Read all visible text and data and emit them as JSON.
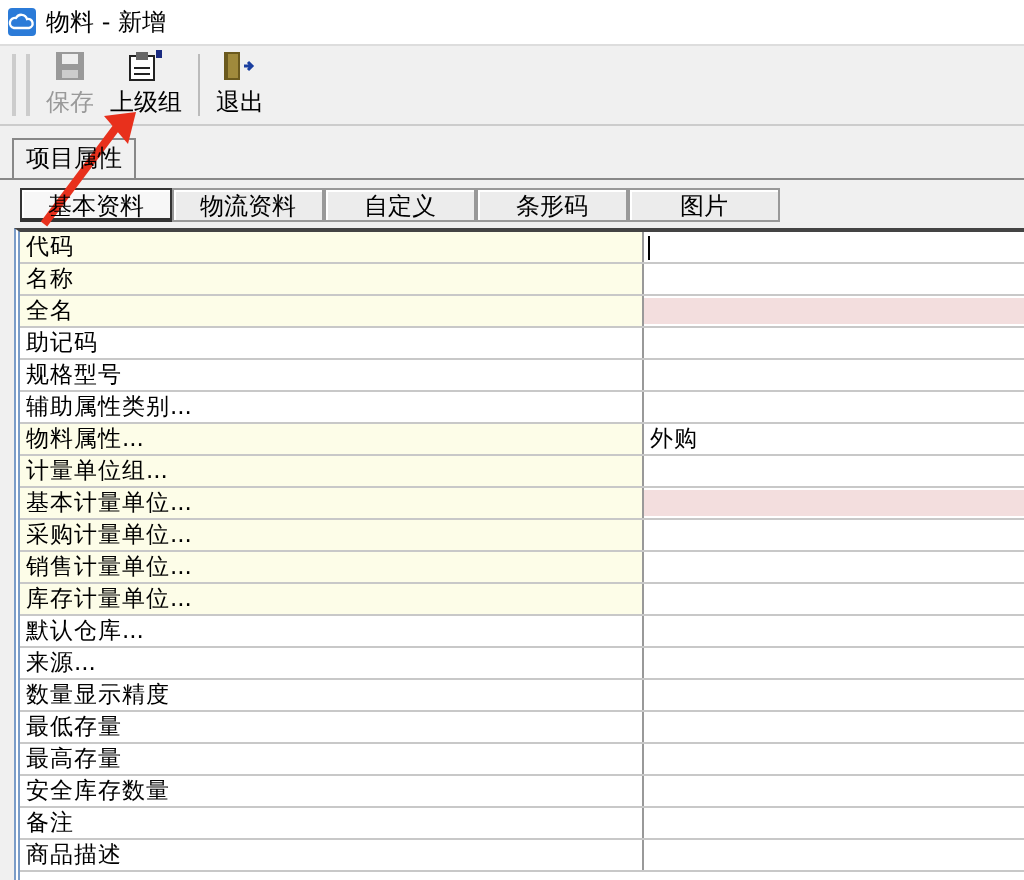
{
  "window": {
    "title": "物料 - 新增"
  },
  "toolbar": [
    {
      "label": "保存",
      "kind": "save",
      "disabled": true
    },
    {
      "label": "上级组",
      "kind": "group",
      "disabled": false
    },
    {
      "label": "退出",
      "kind": "exit",
      "disabled": false
    }
  ],
  "tabs": [
    {
      "label": "项目属性",
      "selected": true
    }
  ],
  "subtabs": [
    {
      "label": "基本资料",
      "selected": true
    },
    {
      "label": "物流资料",
      "selected": false
    },
    {
      "label": "自定义",
      "selected": false
    },
    {
      "label": "条形码",
      "selected": false
    },
    {
      "label": "图片",
      "selected": false
    }
  ],
  "rows": [
    {
      "label": "代码",
      "required": true,
      "highlight": false,
      "focused": true
    },
    {
      "label": "名称",
      "required": true,
      "highlight": false,
      "focused": false
    },
    {
      "label": "全名",
      "required": true,
      "highlight": true,
      "focused": false
    },
    {
      "label": "助记码",
      "required": false,
      "highlight": false,
      "focused": false
    },
    {
      "label": "规格型号",
      "required": false,
      "highlight": false,
      "focused": false
    },
    {
      "label": "辅助属性类别...",
      "required": false,
      "highlight": false,
      "focused": false
    },
    {
      "label": "物料属性...",
      "required": true,
      "highlight": false,
      "focused": false,
      "value": "外购"
    },
    {
      "label": "计量单位组...",
      "required": true,
      "highlight": false,
      "focused": false
    },
    {
      "label": "基本计量单位...",
      "required": true,
      "highlight": true,
      "focused": false
    },
    {
      "label": "采购计量单位...",
      "required": true,
      "highlight": false,
      "focused": false
    },
    {
      "label": "销售计量单位...",
      "required": true,
      "highlight": false,
      "focused": false
    },
    {
      "label": "库存计量单位...",
      "required": true,
      "highlight": false,
      "focused": false
    },
    {
      "label": "默认仓库...",
      "required": false,
      "highlight": false,
      "focused": false
    },
    {
      "label": "来源...",
      "required": false,
      "highlight": false,
      "focused": false
    },
    {
      "label": "数量显示精度",
      "required": false,
      "highlight": false,
      "focused": false
    },
    {
      "label": "最低存量",
      "required": false,
      "highlight": false,
      "focused": false
    },
    {
      "label": "最高存量",
      "required": false,
      "highlight": false,
      "focused": false
    },
    {
      "label": "安全库存数量",
      "required": false,
      "highlight": false,
      "focused": false
    },
    {
      "label": "备注",
      "required": false,
      "highlight": false,
      "focused": false
    },
    {
      "label": "商品描述",
      "required": false,
      "highlight": false,
      "focused": false
    }
  ]
}
